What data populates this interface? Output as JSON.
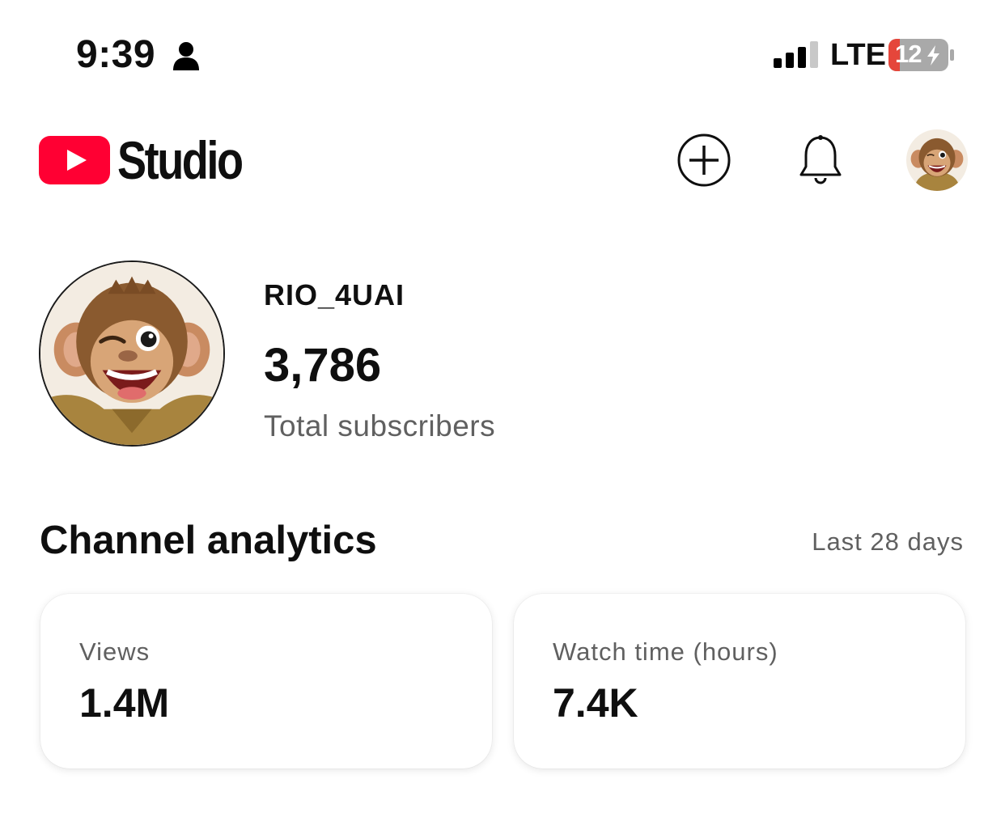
{
  "status_bar": {
    "time": "9:39",
    "network": "LTE",
    "battery": "12",
    "battery_color": "#e5463b"
  },
  "header": {
    "app_name": "Studio",
    "brand_color": "#ff0033",
    "icons": [
      "youtube-logo-icon",
      "create-plus-icon",
      "notifications-bell-icon",
      "account-avatar"
    ]
  },
  "channel": {
    "name": "RIO_4UAI",
    "subscriber_count": "3,786",
    "subscriber_label": "Total subscribers"
  },
  "analytics": {
    "title": "Channel analytics",
    "period": "Last 28 days",
    "cards": [
      {
        "label": "Views",
        "value": "1.4M"
      },
      {
        "label": "Watch time (hours)",
        "value": "7.4K"
      }
    ]
  }
}
